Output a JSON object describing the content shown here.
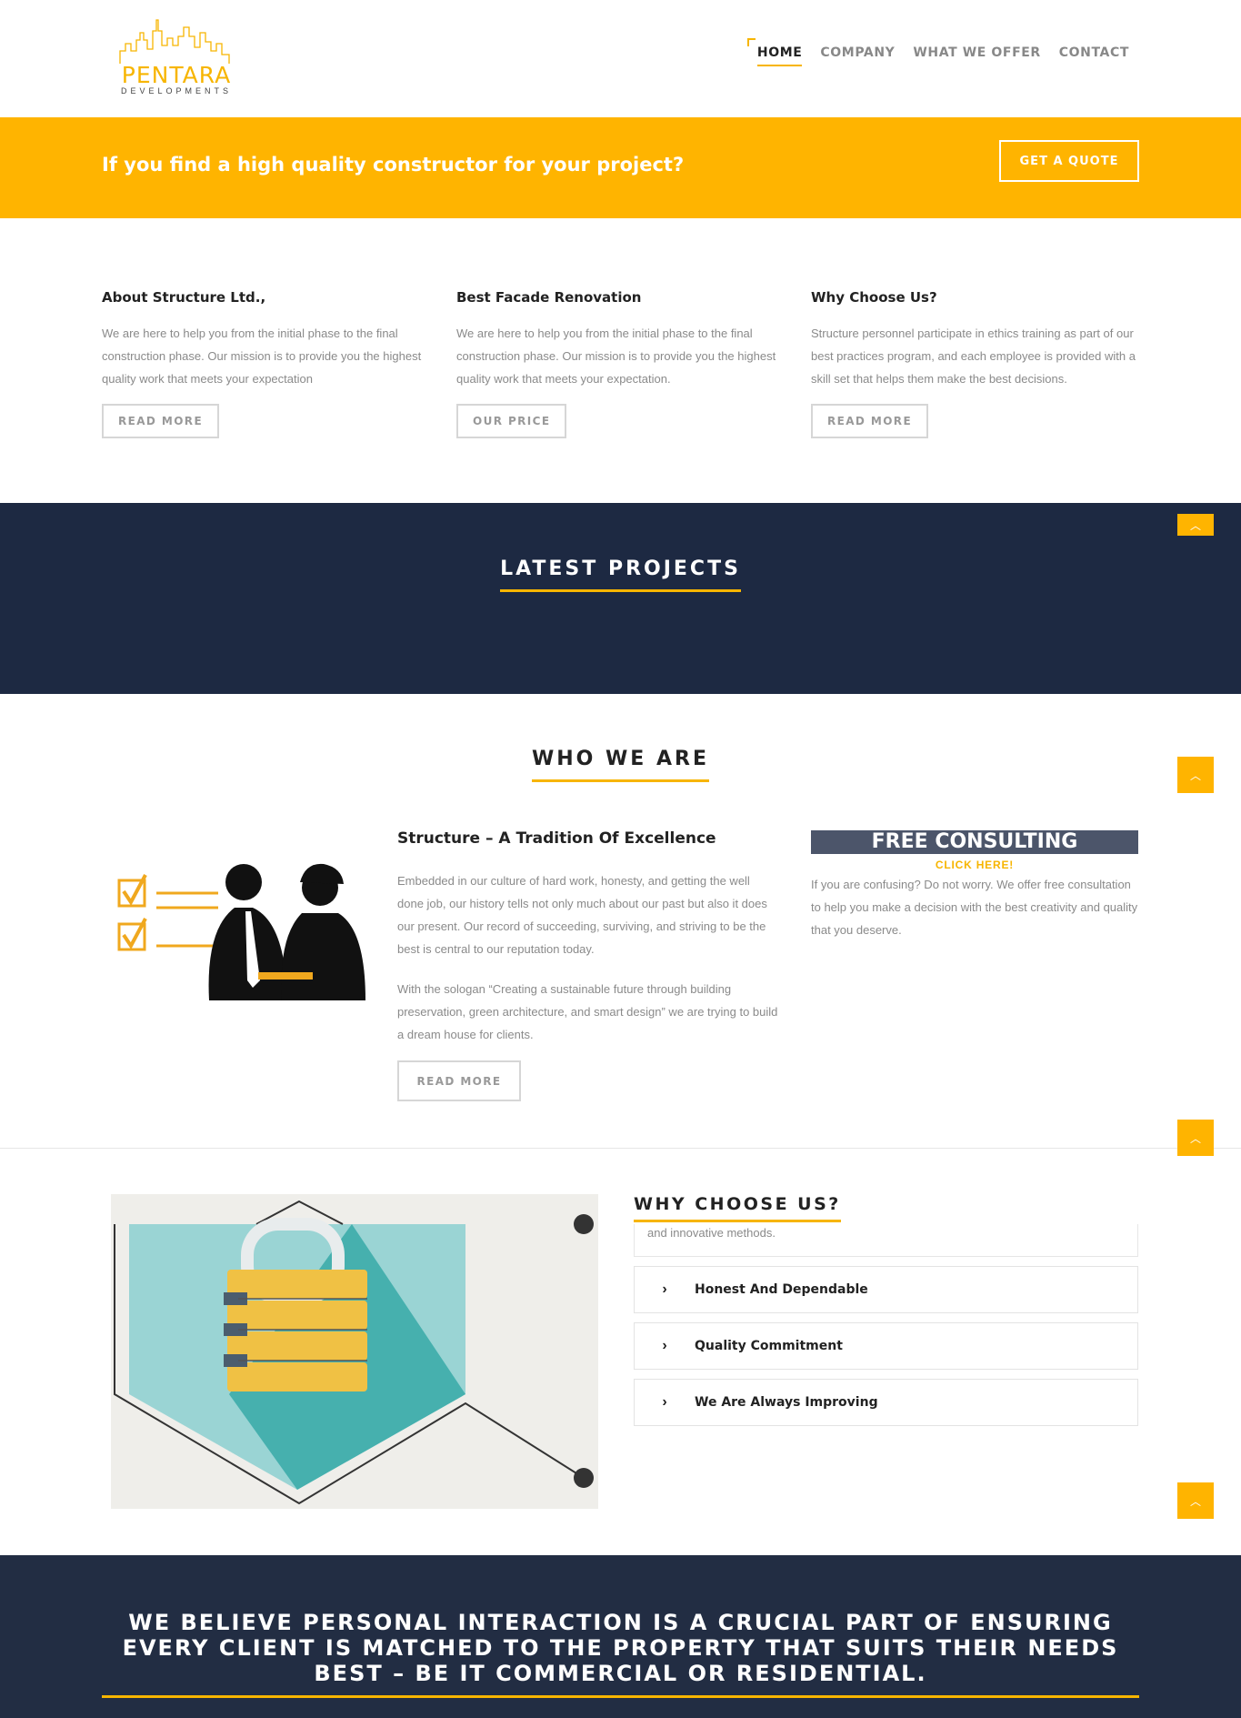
{
  "brand": {
    "name": "PENTARA",
    "tagline": "DEVELOPMENTS",
    "accent": "#ffb400",
    "navy": "#1d2942"
  },
  "nav": [
    {
      "label": "HOME",
      "active": true
    },
    {
      "label": "COMPANY",
      "active": false
    },
    {
      "label": "WHAT WE OFFER",
      "active": false
    },
    {
      "label": "CONTACT",
      "active": false
    }
  ],
  "quote_bar": {
    "text": "If you find a high quality constructor for your project?",
    "button": "GET A QUOTE"
  },
  "services": [
    {
      "title": "About Structure Ltd.,",
      "text": "We are here to help you from the initial phase to the final construction phase. Our mission is to provide you the highest quality work that meets your expectation",
      "button": "READ MORE"
    },
    {
      "title": "Best Facade Renovation",
      "text": "We are here to help you from the initial phase to the final construction phase. Our mission is to provide you the highest quality work that meets your expectation.",
      "button": "OUR PRICE"
    },
    {
      "title": "Why Choose Us?",
      "text": "Structure personnel participate in ethics training as part of our best practices program, and each employee is provided with a skill set that helps them make the best decisions.",
      "button": "READ MORE"
    }
  ],
  "projects": {
    "title": "LATEST PROJECTS"
  },
  "scroll_top_icon": "chevron-up-icon",
  "who": {
    "title": "WHO WE ARE",
    "heading": "Structure – A Tradition Of Excellence",
    "p1": "Embedded in our culture of hard work, honesty, and getting the well done job, our history tells not only much about our past but also it does our present. Our record of succeeding, surviving, and striving to be the best is central to our reputation today.",
    "p2": "With the sologan “Creating a sustainable future through building preservation, green architecture, and smart design” we are trying to build a dream house for clients.",
    "button": "READ MORE",
    "consult_banner": "FREE CONSULTING",
    "consult_click": "CLICK HERE!",
    "consult_text": "If you are confusing? Do not worry. We offer free consultation to help you make a decision with the best creativity and quality that you deserve."
  },
  "why": {
    "title": "WHY CHOOSE US?",
    "partial_text": "and innovative methods.",
    "items": [
      "Honest And Dependable",
      "Quality Commitment",
      "We Are Always Improving"
    ]
  },
  "statement": "WE BELIEVE PERSONAL INTERACTION IS A CRUCIAL PART OF ENSURING EVERY CLIENT IS MATCHED TO THE PROPERTY THAT SUITS THEIR NEEDS BEST – BE IT COMMERCIAL OR RESIDENTIAL."
}
